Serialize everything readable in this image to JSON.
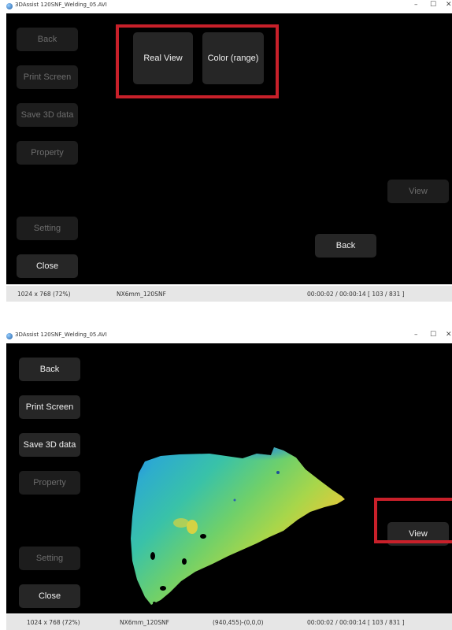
{
  "window_title": "3DAssist 120SNF_Welding_05.AVI",
  "window_controls": {
    "minimize": "–",
    "maximize": "☐",
    "close": "✕"
  },
  "colors": {
    "highlight": "#c8202a",
    "viewport": "#000000",
    "button": "#222222"
  },
  "screen1": {
    "sidebar": {
      "back": "Back",
      "print_screen": "Print Screen",
      "save_3d": "Save 3D data",
      "property": "Property",
      "setting": "Setting",
      "close": "Close"
    },
    "view_buttons": {
      "real_view": "Real View",
      "color_range": "Color (range)"
    },
    "view_button": "View",
    "back_button": "Back",
    "status": {
      "resolution": "1024 x 768 (72%)",
      "model": "NX6mm_120SNF",
      "time": "00:00:02 / 00:00:14  [ 103 / 831 ]"
    }
  },
  "screen2": {
    "sidebar": {
      "back": "Back",
      "print_screen": "Print Screen",
      "save_3d": "Save 3D data",
      "property": "Property",
      "setting": "Setting",
      "close": "Close"
    },
    "view_button": "View",
    "status": {
      "resolution": "1024 x 768 (72%)",
      "model": "NX6mm_120SNF",
      "coords": "(940,455)-(0,0,0)",
      "time": "00:00:02 / 00:00:14  [ 103 / 831 ]"
    }
  }
}
